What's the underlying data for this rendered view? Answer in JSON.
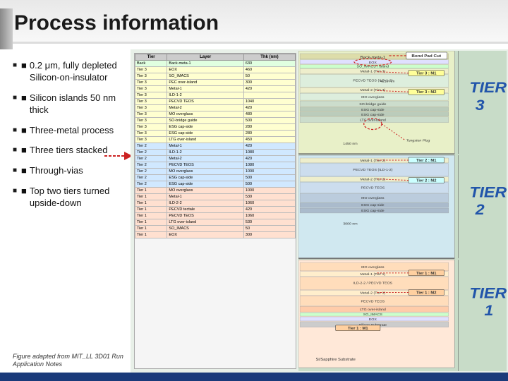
{
  "header": {
    "title": "Process information"
  },
  "bullets": [
    {
      "id": "b1",
      "text": "0.2 μm, fully depleted Silicon-on-insulator"
    },
    {
      "id": "b2",
      "text": "Silicon islands 50 nm thick"
    },
    {
      "id": "b3",
      "text": "Three-metal process"
    },
    {
      "id": "b4",
      "text": "Three tiers stacked"
    },
    {
      "id": "b5",
      "text": "Through-vias"
    },
    {
      "id": "b6",
      "text": "Top two tiers turned upside-down"
    }
  ],
  "figure_caption": "Figure adapted from MIT_LL 3D01 Run Application Notes",
  "table": {
    "headers": [
      "Tier",
      "Layer",
      "Thk (nm)"
    ],
    "rows": [
      [
        "Back",
        "Back-meta-1",
        "630"
      ],
      [
        "Tier 3",
        "EOX",
        "460"
      ],
      [
        "Tier 3",
        "SO_IMACS",
        "50"
      ],
      [
        "Tier 3",
        "PEC over-island",
        "300"
      ],
      [
        "Tier 3",
        "Metal-1",
        "420"
      ],
      [
        "Tier 3",
        "ILD-1-2",
        ""
      ],
      [
        "Tier 3",
        "PECVD TEOS",
        "1040"
      ],
      [
        "Tier 3",
        "Metal-2",
        "420"
      ],
      [
        "Tier 3",
        "ILD-2-3",
        ""
      ],
      [
        "Tier 3",
        "SO-bridge guide",
        "500"
      ],
      [
        "Tier 3",
        "ESG cap-side",
        "280"
      ],
      [
        "Tier 3",
        "ESG cap-side",
        "280"
      ],
      [
        "Tier 3",
        "LTG over-island",
        "450"
      ],
      [
        "Tier 2",
        "Metal-1",
        "420"
      ],
      [
        "Tier 2",
        "ILD-1-2",
        "1080"
      ],
      [
        "Tier 2",
        "Metal-2",
        "420"
      ],
      [
        "Tier 2",
        "PECVD TEOS",
        "1080"
      ],
      [
        "Tier 2",
        "MO overglass",
        "1000"
      ],
      [
        "Tier 2",
        "ESG cap-side",
        "500"
      ],
      [
        "Tier 2",
        "ESG cap-side",
        "500"
      ],
      [
        "Tier 1",
        "MO overglass",
        "1000"
      ],
      [
        "Tier 1",
        "Metal-1",
        "530"
      ],
      [
        "Tier 1",
        "ILD-2-2",
        "1060"
      ],
      [
        "Tier 1",
        "PECVD tectale",
        "420"
      ],
      [
        "Tier 1",
        "PECVD TEOS",
        "1060"
      ],
      [
        "Tier 1",
        "LTG over-island",
        "530"
      ],
      [
        "Tier 1",
        "SO_IMACS",
        "50"
      ],
      [
        "Tier 1",
        "EOX",
        "300"
      ]
    ]
  },
  "tier_labels": {
    "tier3": "TIER 3",
    "tier2": "TIER 2",
    "tier1": "1"
  },
  "callouts": [
    {
      "id": "c1",
      "text": "Bond Pad Cut"
    },
    {
      "id": "c2",
      "text": "Tier 3 : M1"
    },
    {
      "id": "c3",
      "text": "Tier 3 : M2"
    },
    {
      "id": "c4",
      "text": "Tier 2 : M1"
    },
    {
      "id": "c5",
      "text": "Tier 2 : M2"
    },
    {
      "id": "c6",
      "text": "Tier 1 : M2"
    },
    {
      "id": "c7",
      "text": "Tier 1 : M1"
    }
  ],
  "colors": {
    "header_bg": "#f0f0f0",
    "top_bar": "#1a3a7a",
    "tier3_color": "#ffffd0",
    "tier2_color": "#d0e8ff",
    "tier1_color": "#ffe0d0",
    "tier_label_color": "#2255aa",
    "accent_red": "#cc2222"
  }
}
